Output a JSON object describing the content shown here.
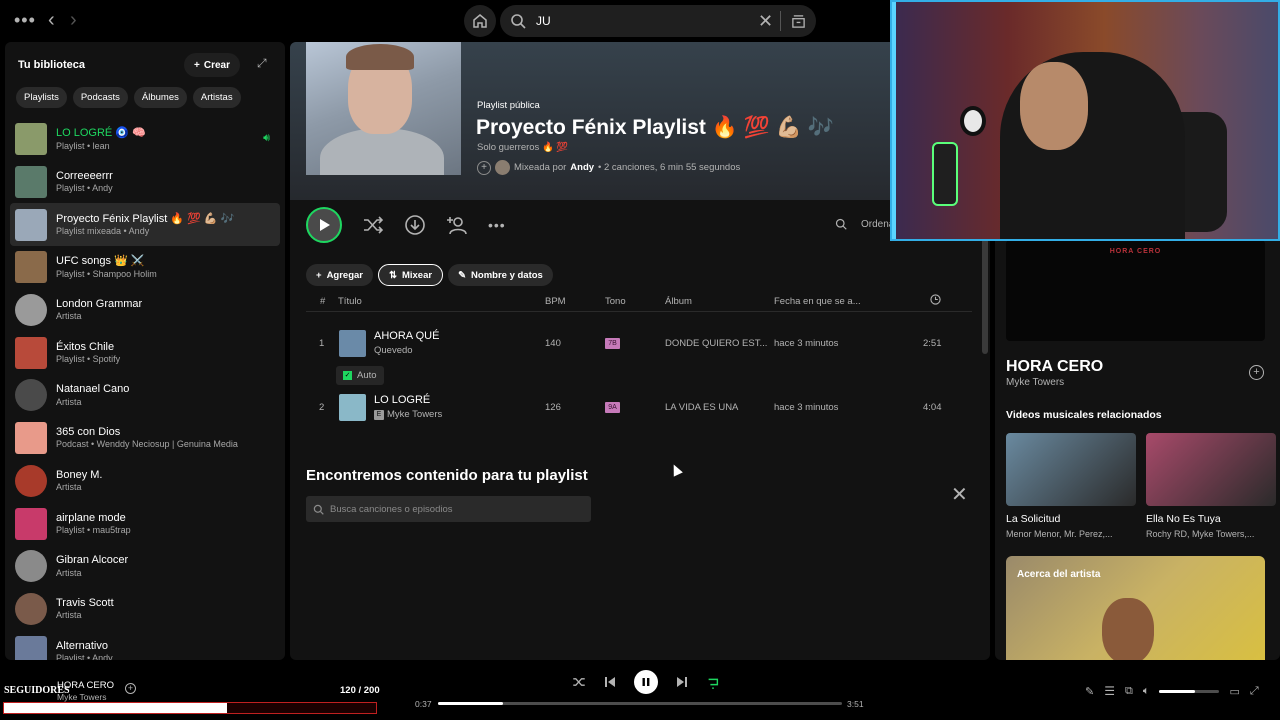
{
  "search": {
    "value": "JU"
  },
  "library": {
    "title": "Tu biblioteca",
    "create_label": "Crear",
    "filters": [
      "Playlists",
      "Podcasts",
      "Álbumes",
      "Artistas"
    ],
    "items": [
      {
        "name": "LO LOGRÉ 🧿 🧠",
        "sub": "Playlist • lean",
        "playing": true,
        "color": "#8a9a6a"
      },
      {
        "name": "Correeeerrr",
        "sub": "Playlist • Andy",
        "color": "#5a7a6a"
      },
      {
        "name": "Proyecto Fénix Playlist 🔥 💯 💪🏼 🎶",
        "sub": "Playlist mixeada • Andy",
        "active": true,
        "color": "#9aa8b8"
      },
      {
        "name": "UFC songs 👑 ⚔️",
        "sub": "Playlist • Shampoo Holim",
        "color": "#8a6a4a"
      },
      {
        "name": "London Grammar",
        "sub": "Artista",
        "round": true,
        "color": "#9a9a9a"
      },
      {
        "name": "Éxitos Chile",
        "sub": "Playlist • Spotify",
        "color": "#b84a3a"
      },
      {
        "name": "Natanael Cano",
        "sub": "Artista",
        "round": true,
        "color": "#4a4a4a"
      },
      {
        "name": "365 con Dios",
        "sub": "Podcast • Wenddy Neciosup | Genuina Media",
        "color": "#e89a8a"
      },
      {
        "name": "Boney M.",
        "sub": "Artista",
        "round": true,
        "color": "#a83a2a"
      },
      {
        "name": "airplane mode",
        "sub": "Playlist • mau5trap",
        "color": "#c83a6a"
      },
      {
        "name": "Gibran Alcocer",
        "sub": "Artista",
        "round": true,
        "color": "#8a8a8a"
      },
      {
        "name": "Travis Scott",
        "sub": "Artista",
        "round": true,
        "color": "#7a5a4a"
      },
      {
        "name": "Alternativo",
        "sub": "Playlist • Andy",
        "color": "#6a7a9a"
      }
    ]
  },
  "playlist": {
    "type": "Playlist pública",
    "title": "Proyecto Fénix Playlist 🔥 💯 💪🏼 🎶",
    "description": "Solo guerreros 🔥 💯",
    "mixed_by_label": "Mixeada por",
    "owner": "Andy",
    "stats": "• 2 canciones, 6 min 55 segundos",
    "sort_label": "Ordenar"
  },
  "tools": {
    "add": "Agregar",
    "mix": "Mixear",
    "details": "Nombre y datos"
  },
  "table": {
    "headers": {
      "num": "#",
      "title": "Título",
      "bpm": "BPM",
      "key": "Tono",
      "album": "Álbum",
      "date": "Fecha en que se a..."
    },
    "rows": [
      {
        "num": "1",
        "title": "AHORA QUÉ",
        "artist": "Quevedo",
        "explicit": false,
        "bpm": "140",
        "key": "7B",
        "album": "DONDE QUIERO EST...",
        "date": "hace 3 minutos",
        "duration": "2:51",
        "color": "#6a8aa8"
      },
      {
        "num": "2",
        "title": "LO LOGRÉ",
        "artist": "Myke Towers",
        "explicit": true,
        "bpm": "126",
        "key": "9A",
        "album": "LA VIDA ES UNA",
        "date": "hace 3 minutos",
        "duration": "4:04",
        "color": "#8ab8c8"
      }
    ],
    "auto_label": "Auto",
    "explicit_badge": "E"
  },
  "find": {
    "title": "Encontremos contenido para tu playlist",
    "placeholder": "Busca canciones o episodios"
  },
  "now_playing_panel": {
    "video_text": "HORA CERO",
    "title": "HORA CERO",
    "artist": "Myke Towers",
    "related_title": "Videos musicales relacionados",
    "videos": [
      {
        "title": "La Solicitud",
        "artists": "Menor Menor, Mr. Perez,...",
        "color": "#6a8aa0"
      },
      {
        "title": "Ella No Es Tuya",
        "artists": "Rochy RD, Myke Towers,...",
        "color": "#a84a6a"
      }
    ],
    "about_label": "Acerca del artista"
  },
  "player": {
    "overlay_label": "SEGUIDORES",
    "overlay_count": "120 / 200",
    "overlay_fraction": 0.6,
    "track": "HORA CERO",
    "artist": "Myke Towers",
    "elapsed": "0:37",
    "total": "3:51",
    "progress": 0.16,
    "volume": 0.6
  }
}
